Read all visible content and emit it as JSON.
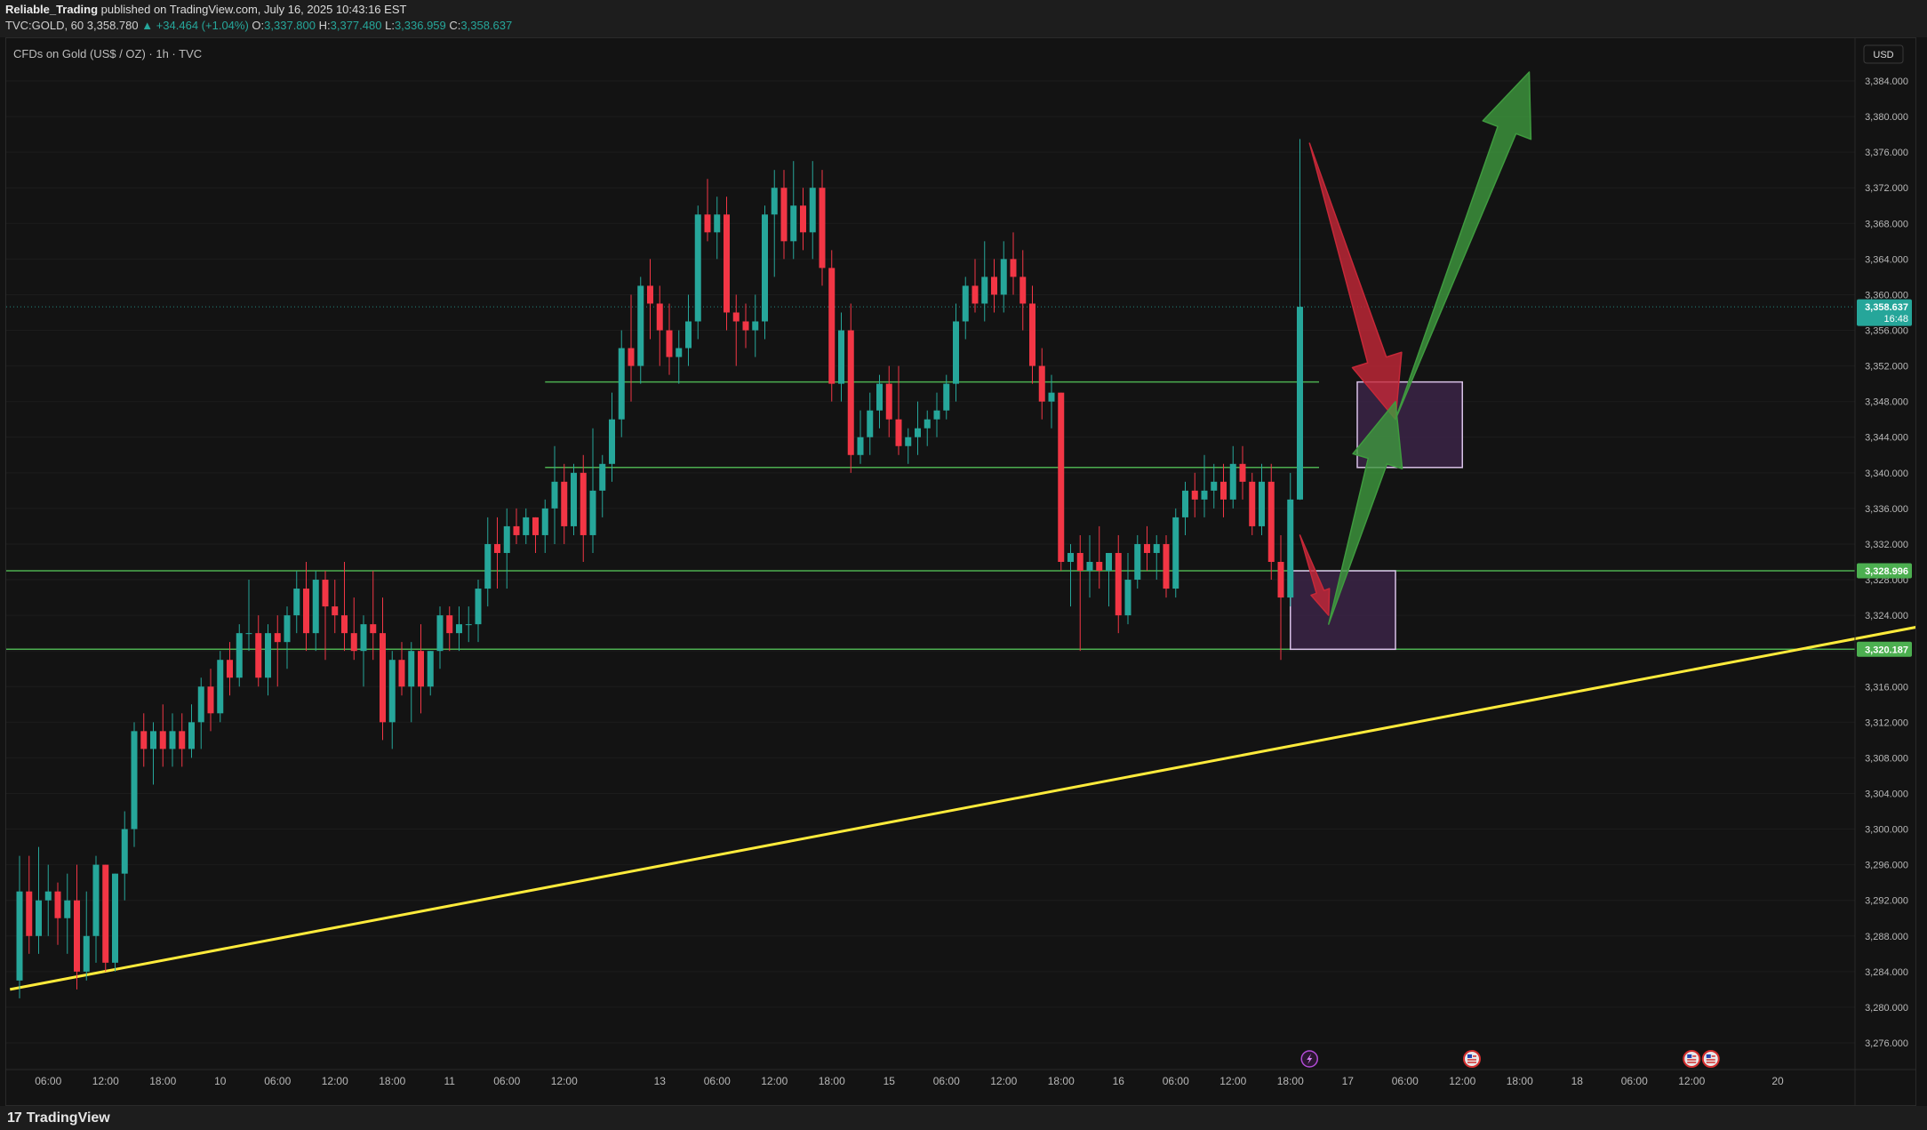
{
  "header": {
    "publisher": "Reliable_Trading",
    "published_text": "published on TradingView.com, July 16, 2025 10:43:16 EST",
    "symbol_line_prefix": "TVC:GOLD, 60",
    "last_price": "3,358.780",
    "change": "▲ +34.464 (+1.04%)",
    "o_label": "O:",
    "o_value": "3,337.800",
    "h_label": "H:",
    "h_value": "3,377.480",
    "l_label": "L:",
    "l_value": "3,336.959",
    "c_label": "C:",
    "c_value": "3,358.637"
  },
  "chart_title": "CFDs on Gold (US$ / OZ) · 1h · TVC",
  "currency_label": "USD",
  "footer": {
    "brand": "TradingView",
    "logo": "17"
  },
  "colors": {
    "background": "#131313",
    "bull": "#26a69a",
    "bear": "#f23645",
    "level_line": "#4caf50",
    "trendline": "#ffeb3b",
    "zone_fill": "#3b2446",
    "zone_border": "#d9c2e8",
    "arrow_red": "#c62838",
    "arrow_green": "#3f9a3f",
    "current_price_tag": "#26a69a"
  },
  "chart_data": {
    "type": "candlestick",
    "title": "CFDs on Gold (US$ / OZ) · 1h · TVC",
    "ylim": [
      3272,
      3387
    ],
    "y_ticks": [
      3276,
      3280,
      3284,
      3288,
      3292,
      3296,
      3300,
      3304,
      3308,
      3312,
      3316,
      3320,
      3324,
      3328,
      3332,
      3336,
      3340,
      3344,
      3348,
      3352,
      3356,
      3360,
      3364,
      3368,
      3372,
      3376,
      3380,
      3384
    ],
    "x_ticks": [
      {
        "label": "06:00",
        "i": 3
      },
      {
        "label": "12:00",
        "i": 9
      },
      {
        "label": "18:00",
        "i": 15
      },
      {
        "label": "10",
        "i": 21
      },
      {
        "label": "06:00",
        "i": 27
      },
      {
        "label": "12:00",
        "i": 33
      },
      {
        "label": "18:00",
        "i": 39
      },
      {
        "label": "11",
        "i": 45
      },
      {
        "label": "06:00",
        "i": 51
      },
      {
        "label": "12:00",
        "i": 57
      },
      {
        "label": "13",
        "i": 67
      },
      {
        "label": "06:00",
        "i": 73
      },
      {
        "label": "12:00",
        "i": 79
      },
      {
        "label": "18:00",
        "i": 85
      },
      {
        "label": "15",
        "i": 91
      },
      {
        "label": "06:00",
        "i": 97
      },
      {
        "label": "12:00",
        "i": 103
      },
      {
        "label": "18:00",
        "i": 109
      },
      {
        "label": "16",
        "i": 115
      },
      {
        "label": "06:00",
        "i": 121
      },
      {
        "label": "12:00",
        "i": 127
      },
      {
        "label": "18:00",
        "i": 133
      },
      {
        "label": "17",
        "i": 139
      },
      {
        "label": "06:00",
        "i": 145
      },
      {
        "label": "12:00",
        "i": 151
      },
      {
        "label": "18:00",
        "i": 157
      },
      {
        "label": "18",
        "i": 163
      },
      {
        "label": "06:00",
        "i": 169
      },
      {
        "label": "12:00",
        "i": 175
      },
      {
        "label": "20",
        "i": 184
      },
      {
        "label": "06:00",
        "i": 191
      }
    ],
    "candles": [
      [
        3283.0,
        3297.0,
        3281.0,
        3293.0
      ],
      [
        3293.0,
        3297.0,
        3286.0,
        3288.0
      ],
      [
        3288.0,
        3298.0,
        3286.0,
        3292.0
      ],
      [
        3292.0,
        3296.0,
        3288.0,
        3293.0
      ],
      [
        3293.0,
        3294.0,
        3287.0,
        3290.0
      ],
      [
        3290.0,
        3295.0,
        3286.0,
        3292.0
      ],
      [
        3292.0,
        3296.0,
        3282.0,
        3284.0
      ],
      [
        3284.0,
        3293.0,
        3283.0,
        3288.0
      ],
      [
        3288.0,
        3297.0,
        3285.0,
        3296.0
      ],
      [
        3296.0,
        3296.0,
        3284.0,
        3285.0
      ],
      [
        3285.0,
        3295.0,
        3284.0,
        3295.0
      ],
      [
        3295.0,
        3302.0,
        3292.0,
        3300.0
      ],
      [
        3300.0,
        3312.0,
        3298.0,
        3311.0
      ],
      [
        3311.0,
        3313.0,
        3307.0,
        3309.0
      ],
      [
        3309.0,
        3312.0,
        3305.0,
        3311.0
      ],
      [
        3311.0,
        3314.0,
        3307.0,
        3309.0
      ],
      [
        3309.0,
        3313.0,
        3307.0,
        3311.0
      ],
      [
        3311.0,
        3313.0,
        3307.0,
        3309.0
      ],
      [
        3309.0,
        3314.0,
        3308.0,
        3312.0
      ],
      [
        3312.0,
        3317.0,
        3309.0,
        3316.0
      ],
      [
        3316.0,
        3318.0,
        3311.0,
        3313.0
      ],
      [
        3313.0,
        3320.0,
        3312.0,
        3319.0
      ],
      [
        3319.0,
        3321.0,
        3315.0,
        3317.0
      ],
      [
        3317.0,
        3323.0,
        3316.0,
        3322.0
      ],
      [
        3322.0,
        3328.0,
        3320.0,
        3322.0
      ],
      [
        3322.0,
        3324.0,
        3316.0,
        3317.0
      ],
      [
        3317.0,
        3323.0,
        3315.0,
        3322.0
      ],
      [
        3322.0,
        3324.0,
        3316.0,
        3321.0
      ],
      [
        3321.0,
        3325.0,
        3318.0,
        3324.0
      ],
      [
        3324.0,
        3329.0,
        3322.0,
        3327.0
      ],
      [
        3327.0,
        3330.0,
        3320.0,
        3322.0
      ],
      [
        3322.0,
        3329.0,
        3320.0,
        3328.0
      ],
      [
        3328.0,
        3329.0,
        3319.0,
        3325.0
      ],
      [
        3325.0,
        3328.0,
        3322.0,
        3324.0
      ],
      [
        3324.0,
        3330.0,
        3320.0,
        3322.0
      ],
      [
        3322.0,
        3326.0,
        3319.0,
        3320.0
      ],
      [
        3320.0,
        3324.0,
        3316.0,
        3323.0
      ],
      [
        3323.0,
        3329.0,
        3319.0,
        3322.0
      ],
      [
        3322.0,
        3326.0,
        3310.0,
        3312.0
      ],
      [
        3312.0,
        3320.0,
        3309.0,
        3319.0
      ],
      [
        3319.0,
        3321.0,
        3315.0,
        3316.0
      ],
      [
        3316.0,
        3321.0,
        3312.0,
        3320.0
      ],
      [
        3320.0,
        3323.0,
        3313.0,
        3316.0
      ],
      [
        3316.0,
        3320.0,
        3315.0,
        3320.0
      ],
      [
        3320.0,
        3325.0,
        3318.0,
        3324.0
      ],
      [
        3324.0,
        3325.0,
        3320.0,
        3322.0
      ],
      [
        3322.0,
        3325.0,
        3320.0,
        3323.0
      ],
      [
        3323.0,
        3325.0,
        3321.0,
        3323.0
      ],
      [
        3323.0,
        3328.0,
        3321.0,
        3327.0
      ],
      [
        3327.0,
        3335.0,
        3325.0,
        3332.0
      ],
      [
        3332.0,
        3335.0,
        3327.0,
        3331.0
      ],
      [
        3331.0,
        3336.0,
        3327.0,
        3334.0
      ],
      [
        3334.0,
        3336.0,
        3332.0,
        3333.0
      ],
      [
        3333.0,
        3336.0,
        3332.0,
        3335.0
      ],
      [
        3335.0,
        3335.0,
        3331.0,
        3333.0
      ],
      [
        3333.0,
        3337.0,
        3331.0,
        3336.0
      ],
      [
        3336.0,
        3343.0,
        3332.0,
        3339.0
      ],
      [
        3339.0,
        3341.0,
        3332.0,
        3334.0
      ],
      [
        3334.0,
        3341.0,
        3333.0,
        3340.0
      ],
      [
        3340.0,
        3342.0,
        3330.0,
        3333.0
      ],
      [
        3333.0,
        3345.0,
        3331.0,
        3338.0
      ],
      [
        3338.0,
        3342.0,
        3335.0,
        3341.0
      ],
      [
        3341.0,
        3349.0,
        3339.0,
        3346.0
      ],
      [
        3346.0,
        3356.0,
        3344.0,
        3354.0
      ],
      [
        3354.0,
        3360.0,
        3348.0,
        3352.0
      ],
      [
        3352.0,
        3362.0,
        3350.0,
        3361.0
      ],
      [
        3361.0,
        3364.0,
        3355.0,
        3359.0
      ],
      [
        3359.0,
        3361.0,
        3352.0,
        3356.0
      ],
      [
        3356.0,
        3359.0,
        3351.0,
        3353.0
      ],
      [
        3353.0,
        3356.0,
        3350.0,
        3354.0
      ],
      [
        3354.0,
        3360.0,
        3352.0,
        3357.0
      ],
      [
        3357.0,
        3370.0,
        3355.0,
        3369.0
      ],
      [
        3369.0,
        3373.0,
        3366.0,
        3367.0
      ],
      [
        3367.0,
        3371.0,
        3364.0,
        3369.0
      ],
      [
        3369.0,
        3371.0,
        3356.0,
        3358.0
      ],
      [
        3358.0,
        3360.0,
        3352.0,
        3357.0
      ],
      [
        3357.0,
        3359.0,
        3354.0,
        3356.0
      ],
      [
        3356.0,
        3360.0,
        3353.0,
        3357.0
      ],
      [
        3357.0,
        3370.0,
        3355.0,
        3369.0
      ],
      [
        3369.0,
        3374.0,
        3362.0,
        3372.0
      ],
      [
        3372.0,
        3374.0,
        3364.0,
        3366.0
      ],
      [
        3366.0,
        3375.0,
        3364.0,
        3370.0
      ],
      [
        3370.0,
        3372.0,
        3365.0,
        3367.0
      ],
      [
        3367.0,
        3375.0,
        3364.0,
        3372.0
      ],
      [
        3372.0,
        3374.0,
        3361.0,
        3363.0
      ],
      [
        3363.0,
        3365.0,
        3348.0,
        3350.0
      ],
      [
        3350.0,
        3358.0,
        3348.0,
        3356.0
      ],
      [
        3356.0,
        3359.0,
        3340.0,
        3342.0
      ],
      [
        3342.0,
        3347.0,
        3341.0,
        3344.0
      ],
      [
        3344.0,
        3349.0,
        3342.0,
        3347.0
      ],
      [
        3347.0,
        3351.0,
        3345.0,
        3350.0
      ],
      [
        3350.0,
        3352.0,
        3344.0,
        3346.0
      ],
      [
        3346.0,
        3352.0,
        3342.0,
        3343.0
      ],
      [
        3343.0,
        3345.0,
        3341.0,
        3344.0
      ],
      [
        3344.0,
        3348.0,
        3342.0,
        3345.0
      ],
      [
        3345.0,
        3347.0,
        3343.0,
        3346.0
      ],
      [
        3346.0,
        3349.0,
        3344.0,
        3347.0
      ],
      [
        3347.0,
        3351.0,
        3346.0,
        3350.0
      ],
      [
        3350.0,
        3359.0,
        3348.0,
        3357.0
      ],
      [
        3357.0,
        3362.0,
        3355.0,
        3361.0
      ],
      [
        3361.0,
        3364.0,
        3358.0,
        3359.0
      ],
      [
        3359.0,
        3366.0,
        3357.0,
        3362.0
      ],
      [
        3362.0,
        3364.0,
        3358.0,
        3360.0
      ],
      [
        3360.0,
        3366.0,
        3358.0,
        3364.0
      ],
      [
        3364.0,
        3367.0,
        3360.0,
        3362.0
      ],
      [
        3362.0,
        3365.0,
        3356.0,
        3359.0
      ],
      [
        3359.0,
        3361.0,
        3350.0,
        3352.0
      ],
      [
        3352.0,
        3354.0,
        3346.0,
        3348.0
      ],
      [
        3348.0,
        3351.0,
        3345.0,
        3349.0
      ],
      [
        3349.0,
        3349.0,
        3329.0,
        3330.0
      ],
      [
        3330.0,
        3332.0,
        3325.0,
        3331.0
      ],
      [
        3331.0,
        3333.0,
        3320.0,
        3329.0
      ],
      [
        3329.0,
        3333.0,
        3326.0,
        3330.0
      ],
      [
        3330.0,
        3334.0,
        3327.0,
        3329.0
      ],
      [
        3329.0,
        3331.0,
        3325.0,
        3331.0
      ],
      [
        3331.0,
        3333.0,
        3322.0,
        3324.0
      ],
      [
        3324.0,
        3331.0,
        3323.0,
        3328.0
      ],
      [
        3328.0,
        3333.0,
        3327.0,
        3332.0
      ],
      [
        3332.0,
        3334.0,
        3329.0,
        3331.0
      ],
      [
        3331.0,
        3333.0,
        3328.0,
        3332.0
      ],
      [
        3332.0,
        3333.0,
        3326.0,
        3327.0
      ],
      [
        3327.0,
        3336.0,
        3326.0,
        3335.0
      ],
      [
        3335.0,
        3339.0,
        3333.0,
        3338.0
      ],
      [
        3338.0,
        3340.0,
        3335.0,
        3337.0
      ],
      [
        3337.0,
        3342.0,
        3335.0,
        3338.0
      ],
      [
        3338.0,
        3341.0,
        3336.0,
        3339.0
      ],
      [
        3339.0,
        3341.0,
        3335.0,
        3337.0
      ],
      [
        3337.0,
        3343.0,
        3336.0,
        3341.0
      ],
      [
        3341.0,
        3343.0,
        3337.0,
        3339.0
      ],
      [
        3339.0,
        3340.0,
        3333.0,
        3334.0
      ],
      [
        3334.0,
        3341.0,
        3333.0,
        3339.0
      ],
      [
        3339.0,
        3341.0,
        3328.0,
        3330.0
      ],
      [
        3330.0,
        3333.0,
        3319.0,
        3326.0
      ],
      [
        3326.0,
        3340.0,
        3325.0,
        3337.0
      ],
      [
        3337.0,
        3377.48,
        3336.959,
        3358.637
      ]
    ],
    "levels": [
      3350.2,
      3340.6,
      3328.996,
      3320.187
    ],
    "price_tags": [
      {
        "label": "3,358.637",
        "sub": "16:48",
        "color": "#26a69a"
      },
      {
        "label": "3,328.996",
        "color": "#4caf50"
      },
      {
        "label": "3,320.187",
        "color": "#4caf50"
      }
    ],
    "trendline": {
      "start": {
        "i": -1,
        "price": 3282.0
      },
      "end": {
        "i": 205,
        "price": 3324.0
      }
    },
    "zones": [
      {
        "from_i": 140,
        "to_i": 151,
        "top": 3350.2,
        "bottom": 3340.6
      },
      {
        "from_i": 133,
        "to_i": 144,
        "top": 3328.996,
        "bottom": 3320.187
      }
    ],
    "arrows": [
      {
        "color": "red",
        "from": {
          "i": 135,
          "price": 3377.0
        },
        "to": {
          "i": 144,
          "price": 3346.0
        }
      },
      {
        "color": "red",
        "from": {
          "i": 134,
          "price": 3333.0
        },
        "to": {
          "i": 137,
          "price": 3324.0
        }
      },
      {
        "color": "green",
        "from": {
          "i": 137,
          "price": 3323.0
        },
        "to": {
          "i": 144,
          "price": 3348.0
        }
      },
      {
        "color": "green",
        "from": {
          "i": 144,
          "price": 3346.0
        },
        "to": {
          "i": 158,
          "price": 3385.0
        }
      }
    ],
    "event_markers": [
      {
        "i": 135,
        "kind": "lightning"
      },
      {
        "i": 152,
        "kind": "us-flag"
      },
      {
        "i": 175,
        "kind": "us-flag"
      },
      {
        "i": 177,
        "kind": "us-flag"
      }
    ]
  }
}
